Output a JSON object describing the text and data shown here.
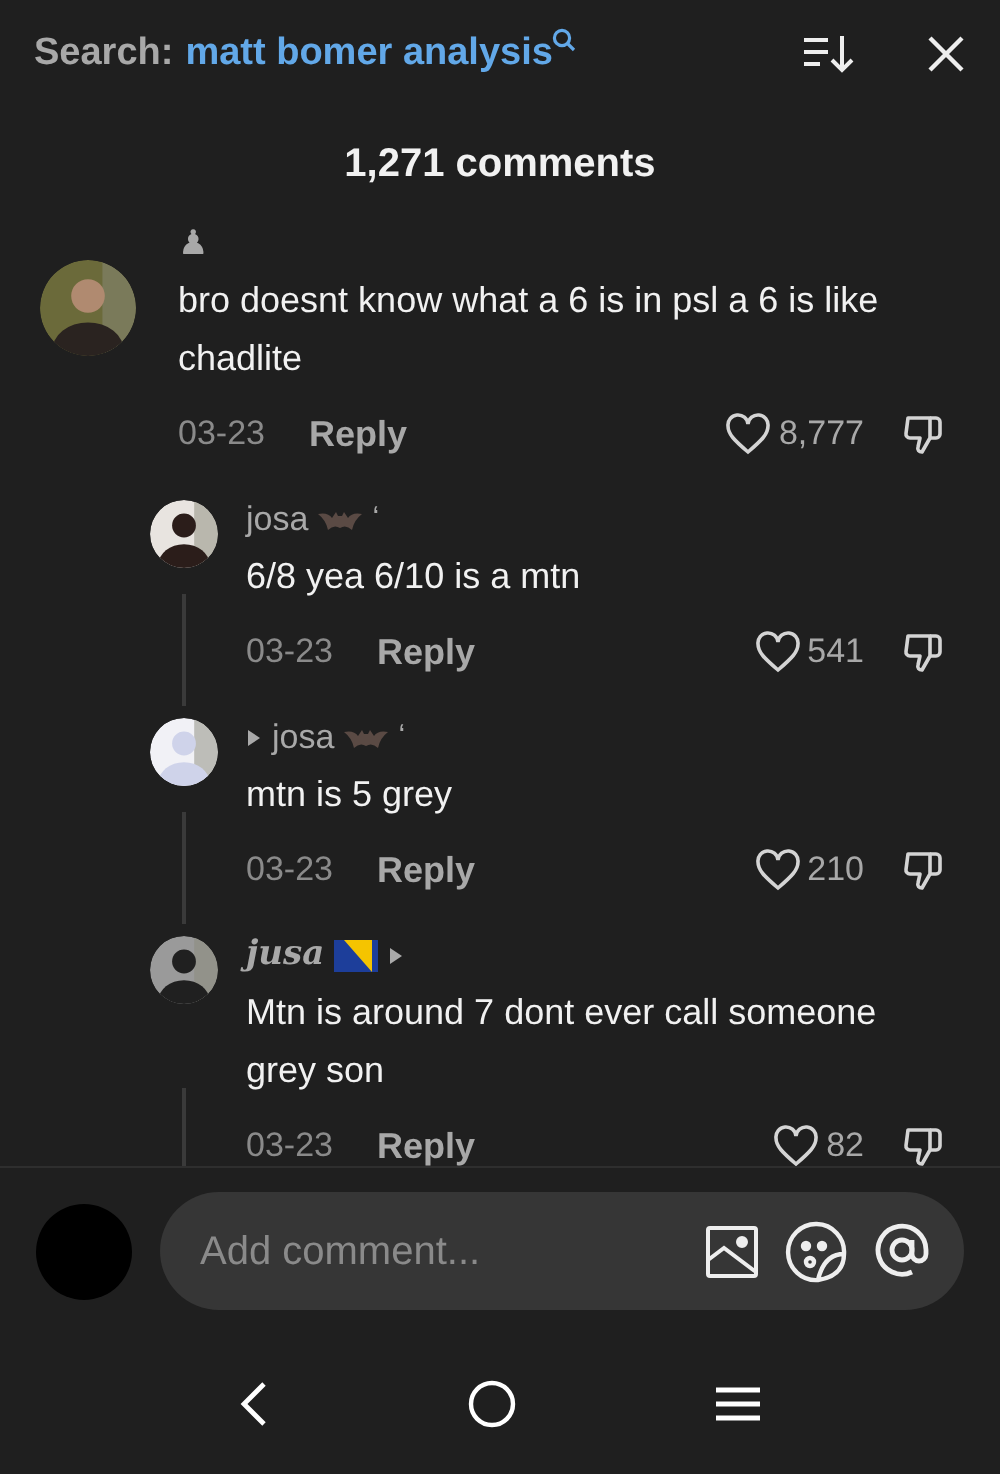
{
  "header": {
    "search_label": "Search:",
    "search_query": "matt bomer analysis"
  },
  "comment_count": "1,271 comments",
  "comments": [
    {
      "username": "♟",
      "arrow_before": false,
      "arrow_after": false,
      "text": "bro doesnt know what a 6 is in psl a 6 is like chadlite",
      "date": "03-23",
      "reply": "Reply",
      "likes": "8,777",
      "children": [
        {
          "username": "josa",
          "kind": "bat",
          "suffix": "ʻ",
          "arrow_before": false,
          "arrow_after": false,
          "text": "6/8 yea 6/10 is a mtn",
          "date": "03-23",
          "reply": "Reply",
          "likes": "541"
        },
        {
          "username": "josa",
          "kind": "bat",
          "suffix": "ʻ",
          "arrow_before": true,
          "arrow_after": false,
          "text": "mtn is 5 grey",
          "date": "03-23",
          "reply": "Reply",
          "likes": "210"
        },
        {
          "username": "jusa",
          "kind": "flag",
          "arrow_before": false,
          "arrow_after": true,
          "text": "Mtn is around 7 dont ever call someone grey son",
          "date": "03-23",
          "reply": "Reply",
          "likes": "82"
        }
      ]
    }
  ],
  "composer": {
    "placeholder": "Add comment..."
  }
}
